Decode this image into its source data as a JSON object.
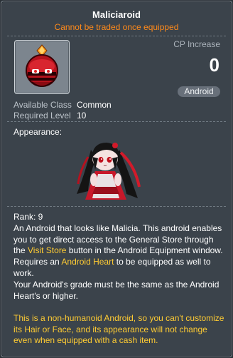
{
  "tooltip": {
    "title": "Maliciaroid",
    "subtitle": "Cannot be traded once equipped",
    "cp_label": "CP Increase",
    "cp_value": "0",
    "type_badge": "Android",
    "available_class_label": "Available Class",
    "available_class_value": "Common",
    "required_level_label": "Required Level",
    "required_level_value": "10",
    "appearance_label": "Appearance:",
    "rank": "Rank: 9",
    "desc_part1": "An Android that looks like Malicia. This android enables you to get direct access to the General Store through the ",
    "desc_link1": "Visit Store",
    "desc_part2": " button in the Android Equipment window. Requires an ",
    "desc_link2": "Android Heart",
    "desc_part3": " to be equipped as well to work.",
    "desc_grade": "Your Android's grade must be the same as the Android Heart's or higher.",
    "note": "This is a non-humanoid Android, so you can't customize its Hair or Face, and its appearance will not change even when equipped with a cash item."
  },
  "colors": {
    "background": "#3b434b",
    "highlight": "#ffcc33",
    "warning": "#ff8a1a"
  }
}
